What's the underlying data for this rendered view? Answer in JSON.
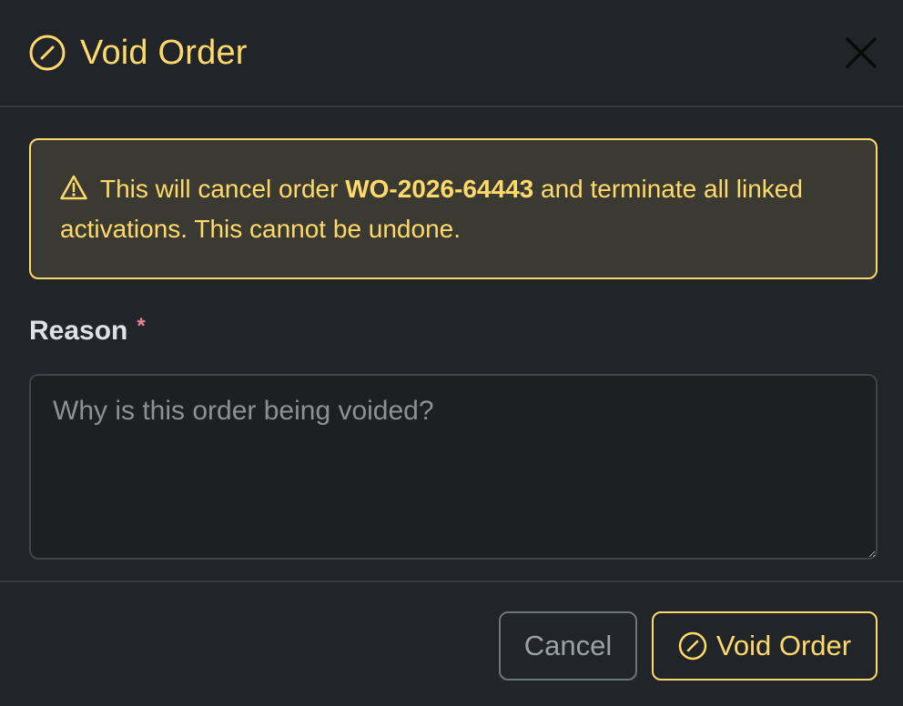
{
  "modal": {
    "title": "Void Order",
    "title_icon": "slash-circle-icon",
    "close_icon": "close-icon"
  },
  "alert": {
    "icon": "warning-triangle-icon",
    "text_before": "This will cancel order ",
    "order_id": "WO-2026-64443",
    "text_after": " and terminate all linked activations. This cannot be undone."
  },
  "form": {
    "reason_label": "Reason",
    "required_marker": "*",
    "reason_placeholder": "Why is this order being voided?",
    "reason_value": ""
  },
  "footer": {
    "cancel_label": "Cancel",
    "void_label": "Void Order",
    "void_icon": "slash-circle-icon"
  },
  "colors": {
    "background": "#212529",
    "warning": "#ffda6a",
    "alert_bg": "#3a3a33",
    "required": "#ea868f",
    "divider": "#373b3e"
  }
}
